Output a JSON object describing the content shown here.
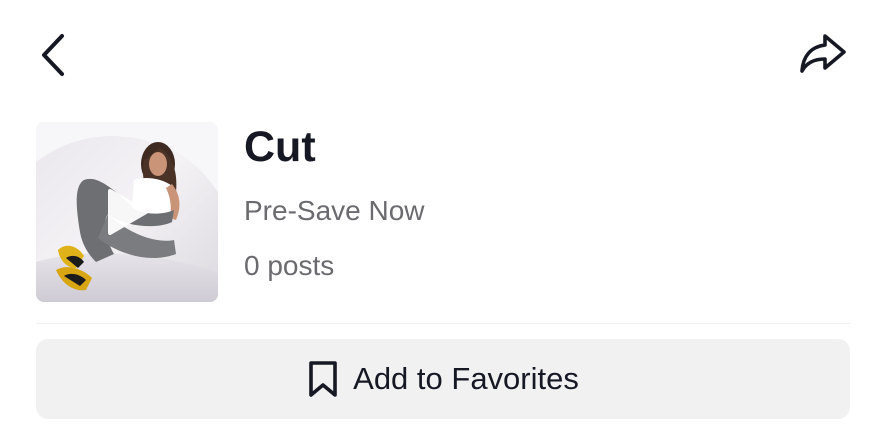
{
  "header": {
    "back_icon": "chevron-left-icon",
    "share_icon": "share-arrow-icon"
  },
  "sound": {
    "cover_play_icon": "play-icon",
    "title": "Cut",
    "subtitle": "Pre-Save Now",
    "posts": "0 posts"
  },
  "actions": {
    "favorite_label": "Add to Favorites",
    "favorite_icon": "bookmark-icon"
  },
  "colors": {
    "text_primary": "#161823",
    "text_secondary": "#6b6b6f",
    "button_bg": "#f1f1f2"
  }
}
